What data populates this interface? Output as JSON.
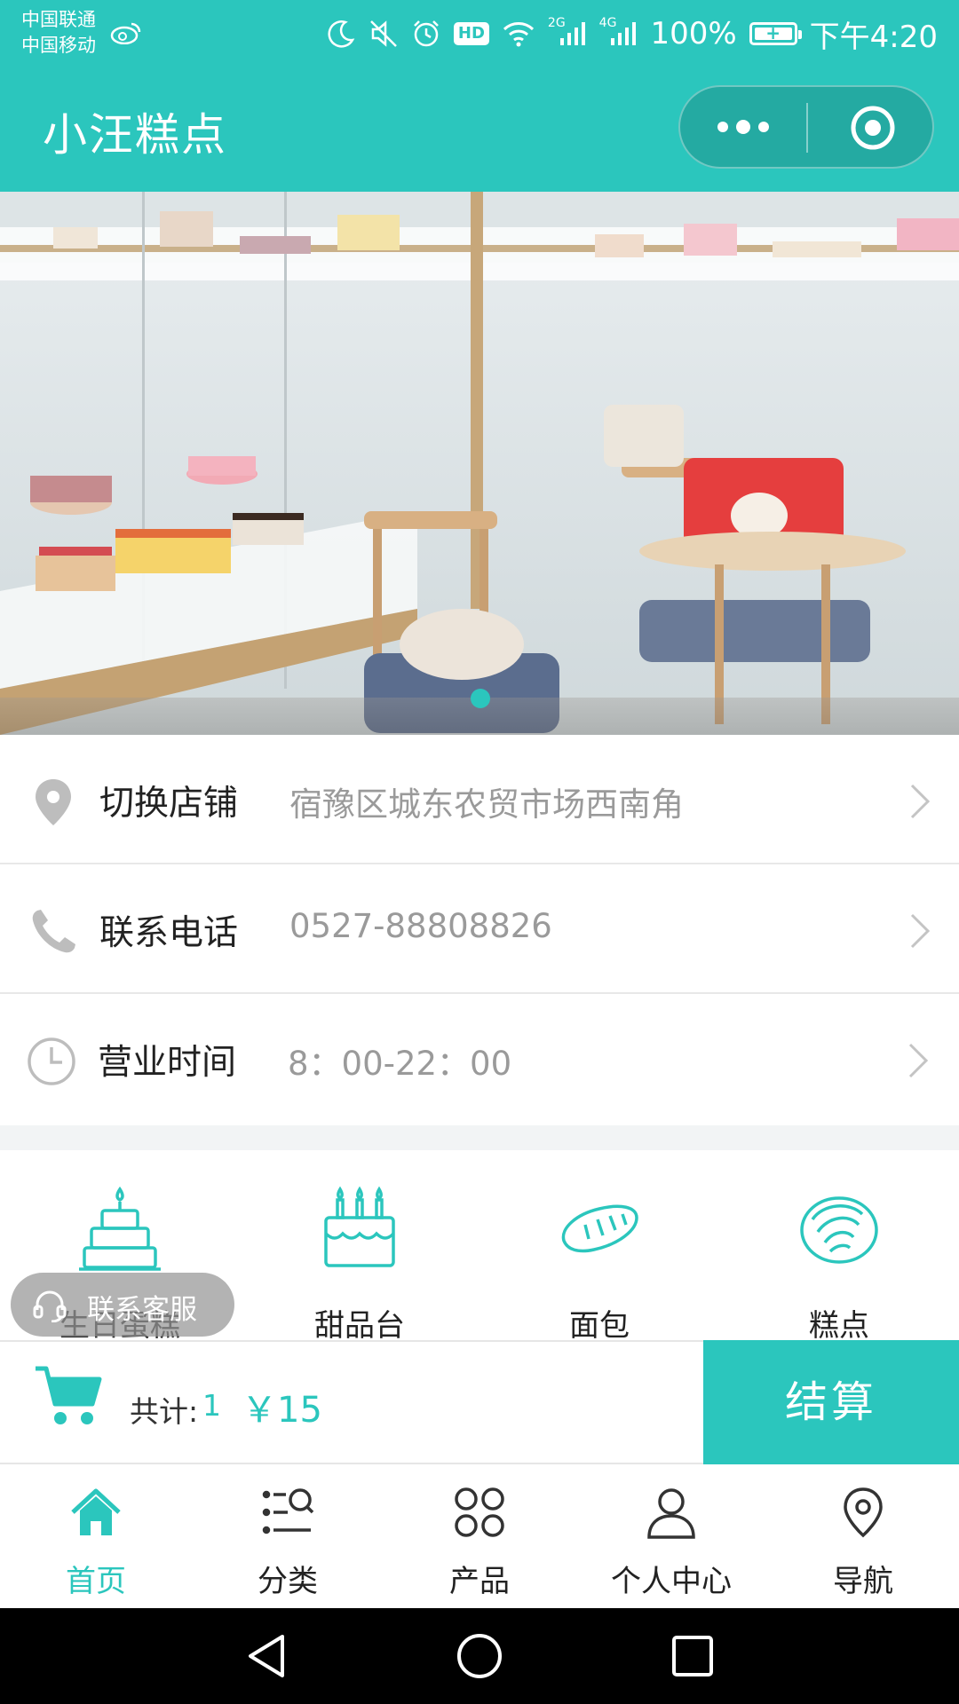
{
  "status_bar": {
    "carrier_1": "中国联通",
    "carrier_2": "中国移动",
    "network_1": "2G",
    "network_2": "4G",
    "battery": "100%",
    "time": "下午4:20",
    "hd": "HD"
  },
  "nav": {
    "title": "小汪糕点"
  },
  "store": {
    "switch_label": "切换店铺",
    "address": "宿豫区城东农贸市场西南角",
    "phone_label": "联系电话",
    "phone": "0527-88808826",
    "hours_label": "营业时间",
    "hours": "8：00-22：00"
  },
  "categories": [
    {
      "label": "生日蛋糕",
      "icon": "birthday-cake-icon"
    },
    {
      "label": "甜品台",
      "icon": "dessert-table-icon"
    },
    {
      "label": "面包",
      "icon": "bread-icon"
    },
    {
      "label": "糕点",
      "icon": "pastry-icon"
    }
  ],
  "customer_service": {
    "label": "联系客服"
  },
  "cart": {
    "total_label": "共计:",
    "count": "1",
    "price": "￥15",
    "checkout_label": "结算"
  },
  "tabs": [
    {
      "label": "首页",
      "icon": "home-icon",
      "active": true
    },
    {
      "label": "分类",
      "icon": "category-icon",
      "active": false
    },
    {
      "label": "产品",
      "icon": "products-icon",
      "active": false
    },
    {
      "label": "个人中心",
      "icon": "profile-icon",
      "active": false
    },
    {
      "label": "导航",
      "icon": "location-pin-icon",
      "active": false
    }
  ],
  "colors": {
    "accent": "#2bc6bd",
    "muted_text": "#9a9a9a",
    "banner_carousel_dot": "#2bc6bd"
  },
  "banner": {
    "slide_count": 1,
    "active_slide": 1
  }
}
